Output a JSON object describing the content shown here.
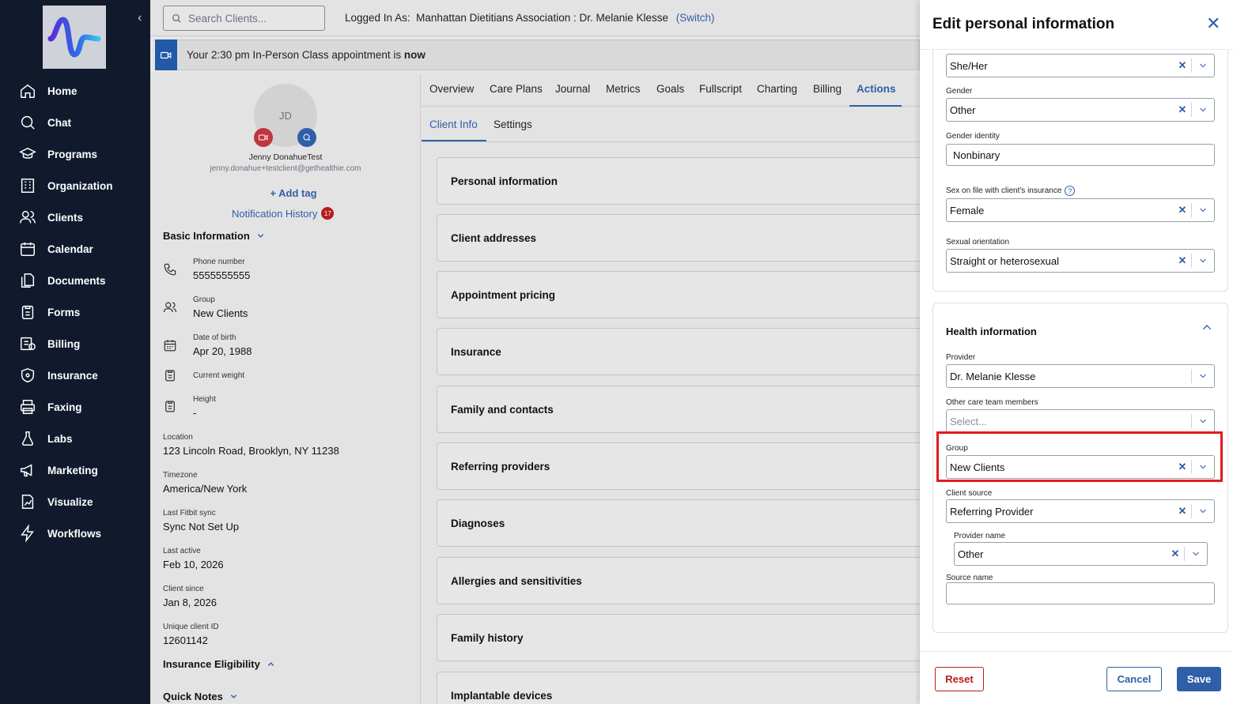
{
  "sidebar": {
    "items": [
      {
        "label": "Home",
        "icon": "home-icon"
      },
      {
        "label": "Chat",
        "icon": "chat-icon"
      },
      {
        "label": "Programs",
        "icon": "graduation-cap-icon"
      },
      {
        "label": "Organization",
        "icon": "building-icon"
      },
      {
        "label": "Clients",
        "icon": "users-icon"
      },
      {
        "label": "Calendar",
        "icon": "calendar-icon"
      },
      {
        "label": "Documents",
        "icon": "documents-icon"
      },
      {
        "label": "Forms",
        "icon": "clipboard-icon"
      },
      {
        "label": "Billing",
        "icon": "billing-icon"
      },
      {
        "label": "Insurance",
        "icon": "shield-icon"
      },
      {
        "label": "Faxing",
        "icon": "printer-icon"
      },
      {
        "label": "Labs",
        "icon": "flask-icon"
      },
      {
        "label": "Marketing",
        "icon": "megaphone-icon"
      },
      {
        "label": "Visualize",
        "icon": "chart-doc-icon"
      },
      {
        "label": "Workflows",
        "icon": "bolt-icon"
      }
    ]
  },
  "topbar": {
    "search_placeholder": "Search Clients...",
    "logged_in_label": "Logged In As:",
    "logged_in_value": "Manhattan Dietitians Association : Dr. Melanie Klesse",
    "switch_label": "(Switch)"
  },
  "banner": {
    "text": "Your 2:30 pm In-Person Class appointment is",
    "emphasis": "now"
  },
  "client": {
    "initials": "JD",
    "name": "Jenny DonahueTest",
    "email": "jenny.donahue+testclient@gethealthie.com",
    "add_tag": "+ Add tag",
    "notification_history": "Notification History",
    "notification_count": "17",
    "basic_info_title": "Basic Information",
    "phone_label": "Phone number",
    "phone_value": "5555555555",
    "group_label": "Group",
    "group_value": "New Clients",
    "dob_label": "Date of birth",
    "dob_value": "Apr 20, 1988",
    "weight_label": "Current weight",
    "height_label": "Height",
    "height_value": "-",
    "location_label": "Location",
    "location_value": "123 Lincoln Road, Brooklyn, NY 11238",
    "timezone_label": "Timezone",
    "timezone_value": "America/New York",
    "fitbit_label": "Last Fitbit sync",
    "fitbit_value": "Sync Not Set Up",
    "last_active_label": "Last active",
    "last_active_value": "Feb 10, 2026",
    "client_since_label": "Client since",
    "client_since_value": "Jan 8, 2026",
    "unique_id_label": "Unique client ID",
    "unique_id_value": "12601142",
    "insurance_eligibility_title": "Insurance Eligibility",
    "quick_notes_title": "Quick Notes"
  },
  "tabs": [
    "Overview",
    "Care Plans",
    "Journal",
    "Metrics",
    "Goals",
    "Fullscript",
    "Charting",
    "Billing",
    "Actions"
  ],
  "subtabs": [
    "Client Info",
    "Settings"
  ],
  "sections": [
    "Personal information",
    "Client addresses",
    "Appointment pricing",
    "Insurance",
    "Family and contacts",
    "Referring providers",
    "Diagnoses",
    "Allergies and sensitivities",
    "Family history",
    "Implantable devices"
  ],
  "drawer": {
    "title": "Edit personal information",
    "pronouns_value": "She/Her",
    "gender_label": "Gender",
    "gender_value": "Other",
    "gender_identity_label": "Gender identity",
    "gender_identity_value": "Nonbinary",
    "sex_label": "Sex on file with client's insurance",
    "sex_value": "Female",
    "orientation_label": "Sexual orientation",
    "orientation_value": "Straight or heterosexual",
    "health_title": "Health information",
    "provider_label": "Provider",
    "provider_value": "Dr. Melanie Klesse",
    "care_team_label": "Other care team members",
    "care_team_placeholder": "Select...",
    "group_label": "Group",
    "group_value": "New Clients",
    "source_label": "Client source",
    "source_value": "Referring Provider",
    "provider_name_label": "Provider name",
    "provider_name_value": "Other",
    "source_name_label": "Source name",
    "source_name_value": "",
    "reset": "Reset",
    "cancel": "Cancel",
    "save": "Save"
  },
  "colors": {
    "accent": "#2f5fa8",
    "sidebar": "#111a2c",
    "highlight": "#e11d1d",
    "reset": "#b91c1c"
  }
}
